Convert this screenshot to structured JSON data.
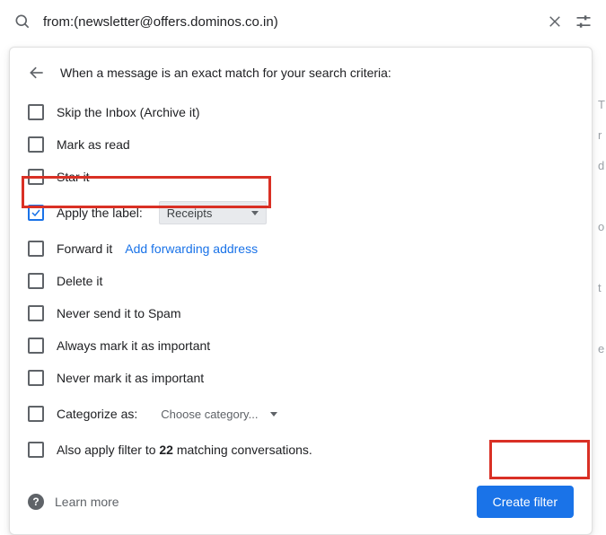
{
  "search": {
    "value": "from:(newsletter@offers.dominos.co.in)"
  },
  "panel": {
    "title": "When a message is an exact match for your search criteria:",
    "options": {
      "skip_inbox": "Skip the Inbox (Archive it)",
      "mark_read": "Mark as read",
      "star": "Star it",
      "apply_label": "Apply the label:",
      "apply_label_value": "Receipts",
      "forward": "Forward it",
      "forward_link": "Add forwarding address",
      "delete": "Delete it",
      "never_spam": "Never send it to Spam",
      "always_important": "Always mark it as important",
      "never_important": "Never mark it as important",
      "categorize": "Categorize as:",
      "categorize_value": "Choose category...",
      "also_apply_prefix": "Also apply filter to ",
      "also_apply_count": "22",
      "also_apply_suffix": " matching conversations."
    },
    "learn_more": "Learn more",
    "create_filter": "Create filter"
  }
}
